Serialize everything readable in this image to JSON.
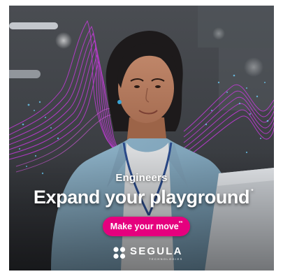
{
  "ad": {
    "eyebrow": "Engineers",
    "headline": "Expand your playground",
    "headline_mark": "*",
    "cta_label": "Make your move",
    "cta_mark": "**",
    "brand_name": "SEGULA",
    "brand_subline": "TECHNOLOGIES",
    "fineprint": "",
    "colors": {
      "accent": "#e5007e",
      "waves": "#c43bd9",
      "particles": "#6fd3ff"
    },
    "icons": [
      "segula-logo-mark-icon"
    ]
  }
}
